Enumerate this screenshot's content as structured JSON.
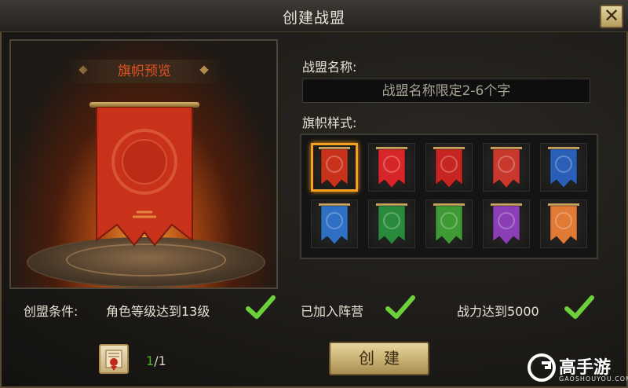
{
  "window": {
    "title": "创建战盟",
    "close_label": "✕"
  },
  "preview": {
    "title": "旗帜预览",
    "banner_color": "#c9321a"
  },
  "form": {
    "name_label": "战盟名称:",
    "name_value": "",
    "name_placeholder": "战盟名称限定2-6个字",
    "style_label": "旗帜样式:"
  },
  "banners": [
    {
      "color": "#c9321a",
      "selected": true
    },
    {
      "color": "#d7262a",
      "selected": false
    },
    {
      "color": "#c72521",
      "selected": false
    },
    {
      "color": "#c8382c",
      "selected": false
    },
    {
      "color": "#2a5fb8",
      "selected": false
    },
    {
      "color": "#2f6fc4",
      "selected": false
    },
    {
      "color": "#2a8a3c",
      "selected": false
    },
    {
      "color": "#3f9a35",
      "selected": false
    },
    {
      "color": "#8a3fb6",
      "selected": false
    },
    {
      "color": "#e07a35",
      "selected": false
    }
  ],
  "conditions": {
    "prefix": "创盟条件:",
    "level": "角色等级达到13级",
    "faction": "已加入阵营",
    "power": "战力达到5000"
  },
  "item": {
    "current": "1",
    "total": "/1"
  },
  "create_label": "创建",
  "watermark": {
    "text": "高手游",
    "sub": "GAOSHOUYOU.COM"
  }
}
